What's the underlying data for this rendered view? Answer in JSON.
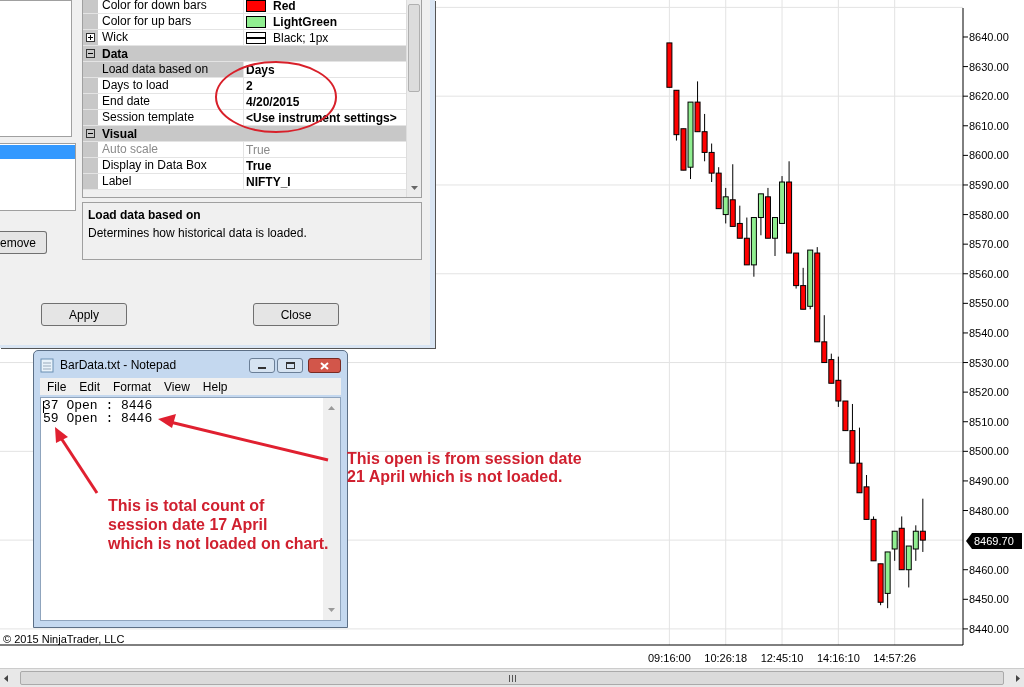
{
  "properties_dialog": {
    "left_button": "emove",
    "property_rows": [
      {
        "kind": "color",
        "label": "Color for down bars",
        "value": "Red",
        "color": "#ff0000",
        "modified": true,
        "selected": false,
        "disabled": false
      },
      {
        "kind": "color",
        "label": "Color for up bars",
        "value": "LightGreen",
        "color": "#90ee90",
        "modified": true,
        "selected": false,
        "disabled": false
      },
      {
        "kind": "pen",
        "label": "Wick",
        "value": "Black; 1px",
        "expanded": false,
        "modified": false,
        "selected": false,
        "disabled": false
      },
      {
        "kind": "category",
        "label": "Data",
        "expanded": true,
        "children": [
          {
            "kind": "text",
            "label": "Load data based on",
            "value": "Days",
            "modified": true,
            "selected": true,
            "disabled": false
          },
          {
            "kind": "text",
            "label": "Days to load",
            "value": "2",
            "modified": true,
            "selected": false,
            "disabled": false
          },
          {
            "kind": "text",
            "label": "End date",
            "value": "4/20/2015",
            "modified": true,
            "selected": false,
            "disabled": false
          },
          {
            "kind": "text",
            "label": "Session template",
            "value": "<Use instrument settings>",
            "modified": true,
            "selected": false,
            "disabled": false
          }
        ]
      },
      {
        "kind": "category",
        "label": "Visual",
        "expanded": true,
        "children": [
          {
            "kind": "text",
            "label": "Auto scale",
            "value": "True",
            "modified": false,
            "selected": false,
            "disabled": true
          },
          {
            "kind": "text",
            "label": "Display in Data Box",
            "value": "True",
            "modified": true,
            "selected": false,
            "disabled": false
          },
          {
            "kind": "text",
            "label": "Label",
            "value": "NIFTY_I",
            "modified": true,
            "selected": false,
            "disabled": false
          }
        ]
      }
    ],
    "description": {
      "title": "Load data based on",
      "text": "Determines how historical data is loaded."
    },
    "buttons": [
      "Apply",
      "Close"
    ]
  },
  "notepad": {
    "title": "BarData.txt - Notepad",
    "menu": [
      "File",
      "Edit",
      "Format",
      "View",
      "Help"
    ],
    "lines": [
      "37 Open : 8446",
      "59 Open : 8446"
    ]
  },
  "chart": {
    "copyright": "© 2015 NinjaTrader, LLC",
    "price_marker": "8469.70",
    "chart_data": {
      "type": "candlestick",
      "grid": true,
      "ylim": [
        8434.56,
        8652.5
      ],
      "categories": [
        "09:16:00",
        null,
        null,
        null,
        null,
        null,
        null,
        null,
        "10:26:18",
        null,
        null,
        null,
        null,
        null,
        null,
        null,
        "12:45:10",
        null,
        null,
        null,
        null,
        null,
        null,
        null,
        "14:16:10",
        null,
        null,
        null,
        null,
        null,
        null,
        null,
        "14:57:26",
        null,
        null,
        null,
        null
      ],
      "yticks": [
        {
          "value": 8440,
          "label": "8440.00"
        },
        {
          "value": 8450,
          "label": "8450.00"
        },
        {
          "value": 8460,
          "label": "8460.00"
        },
        {
          "value": 8480,
          "label": "8480.00"
        },
        {
          "value": 8490,
          "label": "8490.00"
        },
        {
          "value": 8500,
          "label": "8500.00"
        },
        {
          "value": 8510,
          "label": "8510.00"
        },
        {
          "value": 8520,
          "label": "8520.00"
        },
        {
          "value": 8530,
          "label": "8530.00"
        },
        {
          "value": 8540,
          "label": "8540.00"
        },
        {
          "value": 8550,
          "label": "8550.00"
        },
        {
          "value": 8560,
          "label": "8560.00"
        },
        {
          "value": 8570,
          "label": "8570.00"
        },
        {
          "value": 8580,
          "label": "8580.00"
        },
        {
          "value": 8590,
          "label": "8590.00"
        },
        {
          "value": 8600,
          "label": "8600.00"
        },
        {
          "value": 8610,
          "label": "8610.00"
        },
        {
          "value": 8620,
          "label": "8620.00"
        },
        {
          "value": 8630,
          "label": "8630.00"
        },
        {
          "value": 8640,
          "label": "8640.00"
        }
      ],
      "ohlc": [
        [
          8638,
          8638,
          8623,
          8623
        ],
        [
          8622,
          8622,
          8605,
          8607
        ],
        [
          8609,
          8609,
          8595,
          8595
        ],
        [
          8596,
          8618,
          8592,
          8618
        ],
        [
          8618,
          8625,
          8608,
          8608
        ],
        [
          8608,
          8614,
          8598,
          8601
        ],
        [
          8601,
          8604,
          8591,
          8594
        ],
        [
          8594,
          8596,
          8582,
          8582
        ],
        [
          8580,
          8589,
          8577,
          8586
        ],
        [
          8585,
          8597,
          8576,
          8576
        ],
        [
          8577,
          8583,
          8572,
          8572
        ],
        [
          8572,
          8579,
          8563,
          8563
        ],
        [
          8563,
          8579,
          8559,
          8579
        ],
        [
          8579,
          8587,
          8573,
          8587
        ],
        [
          8586,
          8589,
          8572,
          8572
        ],
        [
          8572,
          8579,
          8566,
          8579
        ],
        [
          8577,
          8593,
          8577,
          8591
        ],
        [
          8591,
          8598,
          8567,
          8567
        ],
        [
          8567,
          8567,
          8555,
          8556
        ],
        [
          8556,
          8562,
          8548,
          8548
        ],
        [
          8549,
          8568,
          8548,
          8568
        ],
        [
          8567,
          8569,
          8537,
          8537
        ],
        [
          8537,
          8546,
          8530,
          8530
        ],
        [
          8531,
          8533,
          8523,
          8523
        ],
        [
          8524,
          8532,
          8515,
          8517
        ],
        [
          8517,
          8517,
          8507,
          8507
        ],
        [
          8507,
          8516,
          8496,
          8496
        ],
        [
          8496,
          8508,
          8486,
          8486
        ],
        [
          8488,
          8492,
          8477,
          8477
        ],
        [
          8477,
          8478,
          8463,
          8463
        ],
        [
          8462,
          8462,
          8448,
          8449
        ],
        [
          8452,
          8466,
          8447,
          8466
        ],
        [
          8467,
          8473,
          8463,
          8473
        ],
        [
          8474,
          8478,
          8460,
          8460
        ],
        [
          8460,
          8468,
          8454,
          8468
        ],
        [
          8467,
          8475,
          8463,
          8473
        ],
        [
          8473,
          8484,
          8466,
          8470
        ]
      ]
    }
  },
  "annotations": [
    {
      "lines": [
        "This open is from session date",
        "21 April which is not loaded."
      ]
    },
    {
      "lines": [
        "This is total count of",
        "session date 17 April",
        "which is not loaded on chart."
      ]
    }
  ]
}
